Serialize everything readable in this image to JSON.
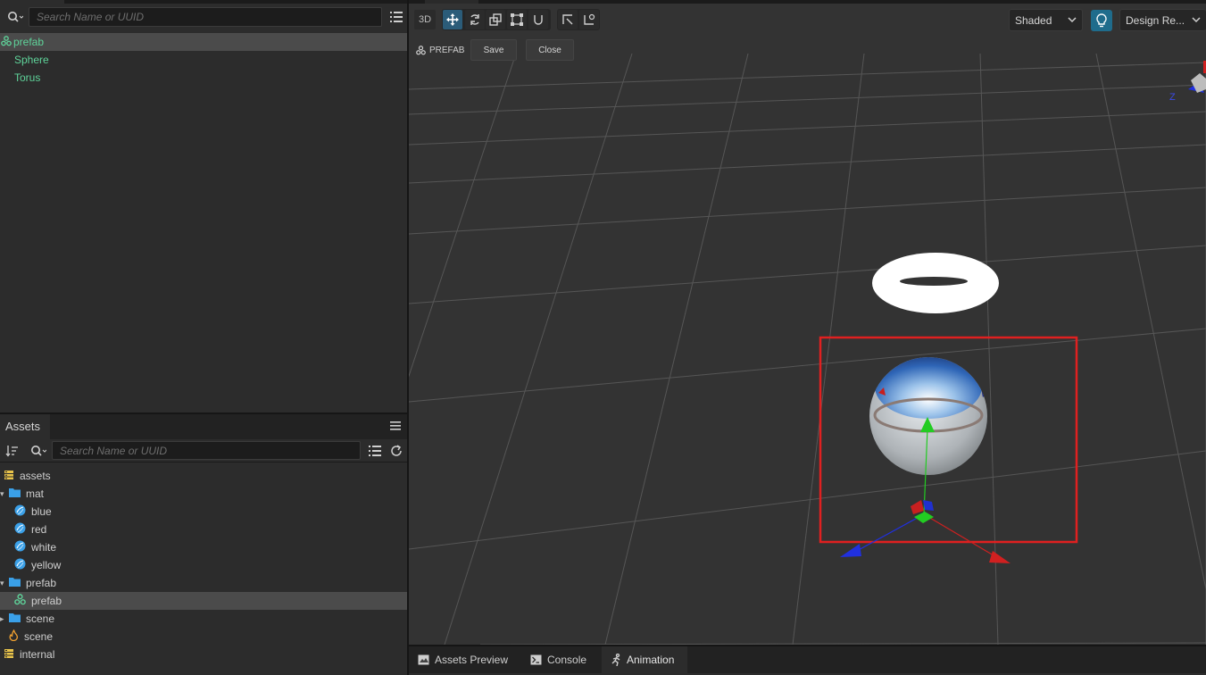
{
  "hierarchy": {
    "search_placeholder": "Search Name or UUID",
    "tree": [
      {
        "label": "prefab",
        "kind": "prefab",
        "selected": true
      },
      {
        "label": "Sphere",
        "kind": "node"
      },
      {
        "label": "Torus",
        "kind": "node"
      }
    ]
  },
  "assets": {
    "tab_label": "Assets",
    "search_placeholder": "Search Name or UUID",
    "tree": [
      {
        "label": "assets"
      },
      {
        "label": "mat"
      },
      {
        "label": "blue"
      },
      {
        "label": "red"
      },
      {
        "label": "white"
      },
      {
        "label": "yellow"
      },
      {
        "label": "prefab"
      },
      {
        "label": "prefab"
      },
      {
        "label": "scene"
      },
      {
        "label": "scene"
      },
      {
        "label": "internal"
      }
    ]
  },
  "scene": {
    "mode_3d": "3D",
    "shading": "Shaded",
    "design_resolution": "Design Re...",
    "prefab_label": "PREFAB",
    "save_label": "Save",
    "close_label": "Close",
    "gizmo_z": "Z"
  },
  "bottom_tabs": [
    {
      "label": "Assets Preview"
    },
    {
      "label": "Console"
    },
    {
      "label": "Animation",
      "active": true
    }
  ],
  "colors": {
    "accent": "#2b5c79",
    "selection_box": "#e02020",
    "node_green": "#5fd39a",
    "folder_blue": "#3aa0e8",
    "assets_yellow": "#e8c34a"
  }
}
